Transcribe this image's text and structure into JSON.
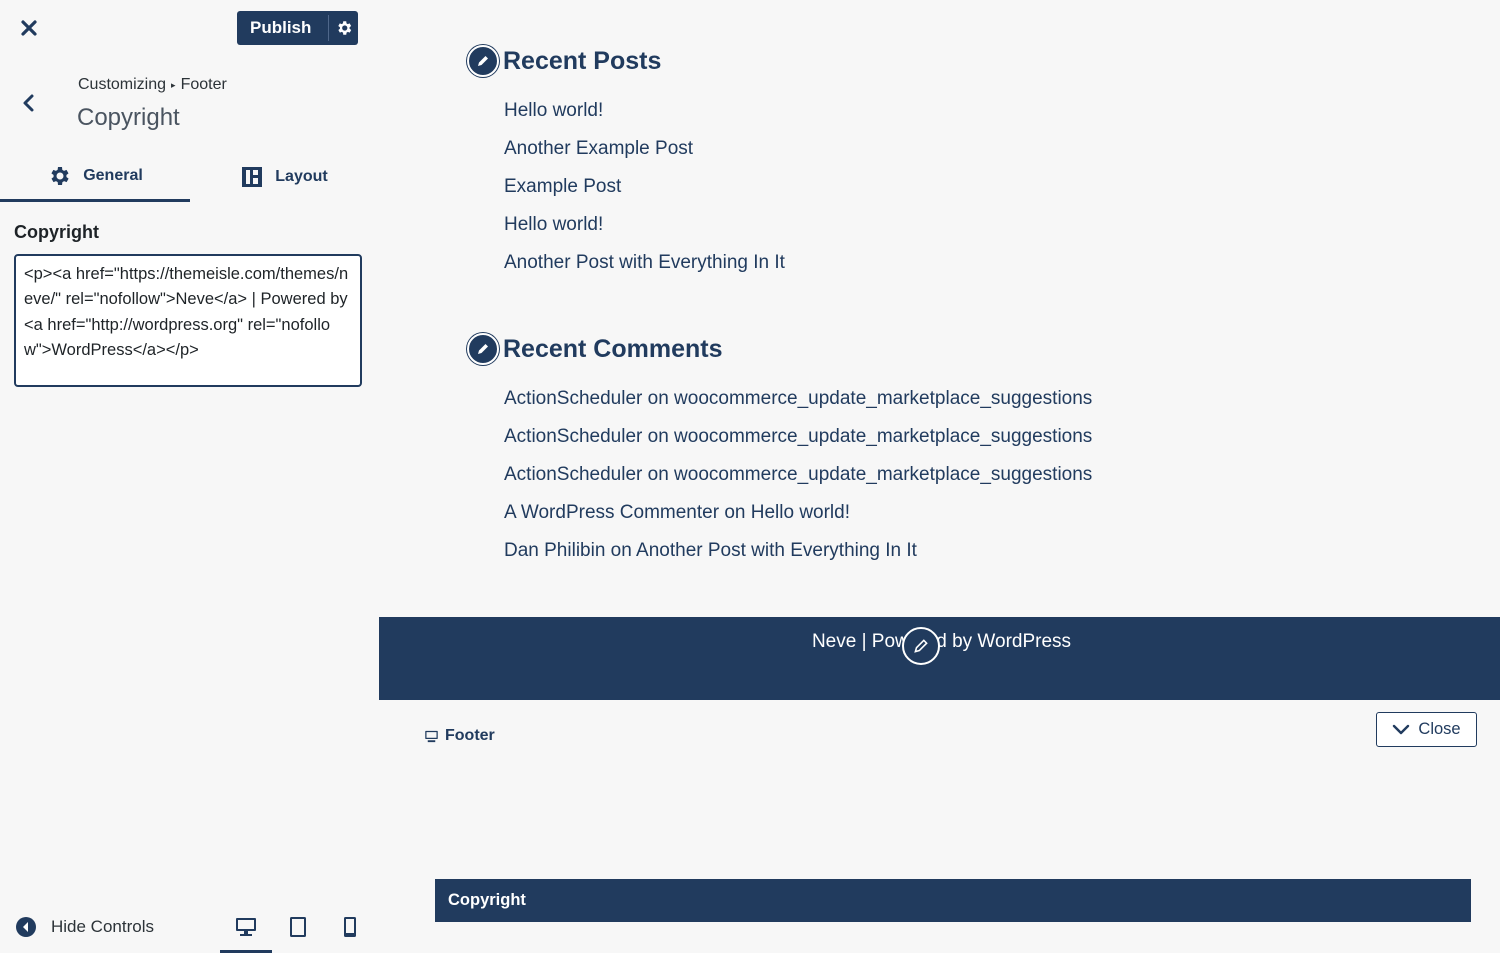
{
  "header": {
    "publish_label": "Publish"
  },
  "breadcrumb": {
    "parent": "Customizing",
    "current": "Footer"
  },
  "section_title": "Copyright",
  "tabs": [
    {
      "label": "General"
    },
    {
      "label": "Layout"
    }
  ],
  "copyright_field": {
    "label": "Copyright",
    "value": "<p><a href=\"https://themeisle.com/themes/neve/\" rel=\"nofollow\">Neve</a> | Powered by <a href=\"http://wordpress.org\" rel=\"nofollow\">WordPress</a></p>"
  },
  "bottom": {
    "hide_controls_label": "Hide Controls"
  },
  "preview": {
    "recent_posts": {
      "title": "Recent Posts",
      "items": [
        "Hello world!",
        "Another Example Post",
        "Example Post",
        "Hello world!",
        "Another Post with Everything In It"
      ]
    },
    "recent_comments": {
      "title": "Recent Comments",
      "items": [
        "ActionScheduler on woocommerce_update_marketplace_suggestions",
        "ActionScheduler on woocommerce_update_marketplace_suggestions",
        "ActionScheduler on woocommerce_update_marketplace_suggestions",
        "A WordPress Commenter on Hello world!",
        "Dan Philibin on Another Post with Everything In It"
      ]
    },
    "footer_text": "Neve | Powered by WordPress",
    "footer_label": "Footer",
    "close_label": "Close",
    "copyright_bar_label": "Copyright"
  },
  "colors": {
    "primary": "#213b5e",
    "background": "#f7f7f7"
  },
  "icons": [
    "close-icon",
    "gear-icon",
    "back-chevron-icon",
    "layout-grid-icon",
    "pencil-icon",
    "desktop-icon",
    "tablet-icon",
    "mobile-icon",
    "hide-controls-icon",
    "chevron-down-icon",
    "footer-monitor-icon"
  ]
}
